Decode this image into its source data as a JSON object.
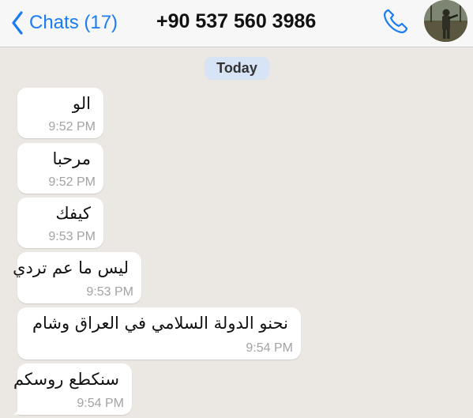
{
  "header": {
    "back_label": "Chats (17)",
    "title": "+90 537 560 3986"
  },
  "day_separator": "Today",
  "messages": [
    {
      "text": "الو",
      "time": "9:52 PM"
    },
    {
      "text": "مرحبا",
      "time": "9:52 PM"
    },
    {
      "text": "كيفك",
      "time": "9:53 PM"
    },
    {
      "text": "ليس ما عم تردي",
      "time": "9:53 PM"
    },
    {
      "text": "نحنو الدولة السلامي في العراق وشام",
      "time": "9:54 PM"
    },
    {
      "text": "سنكطع روسكم",
      "time": "9:54 PM"
    }
  ],
  "colors": {
    "accent": "#1a7cf5",
    "background": "#ebe8e3",
    "bubble": "#ffffff",
    "timestamp": "#a3a3a3"
  },
  "icons": {
    "back": "chevron-left-icon",
    "call": "phone-icon",
    "avatar": "contact-avatar"
  }
}
